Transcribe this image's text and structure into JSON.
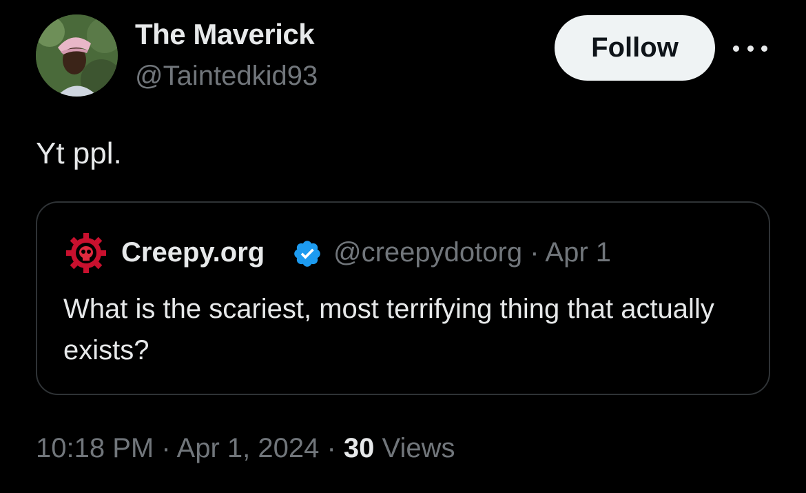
{
  "author": {
    "display_name": "The Maverick",
    "handle": "@Taintedkid93",
    "avatar_icon": "person-photo"
  },
  "actions": {
    "follow_label": "Follow",
    "more_icon": "ellipsis-icon"
  },
  "tweet": {
    "text": "Yt ppl."
  },
  "quoted": {
    "name": "Creepy.org",
    "verified": true,
    "verified_color": "#1d9bf0",
    "handle_date": "@creepydotorg · Apr 1",
    "text": "What is the scariest, most terrifying thing that actually exists?",
    "logo_icon": "skull-gear-logo",
    "logo_color": "#c8102e"
  },
  "meta": {
    "time_date": "10:18 PM · Apr 1, 2024 · ",
    "views_count": "30",
    "views_label": " Views"
  },
  "colors": {
    "background": "#000000",
    "text_primary": "#e7e9ea",
    "text_secondary": "#71767b",
    "border": "#2f3336",
    "button_bg": "#eff3f4"
  }
}
